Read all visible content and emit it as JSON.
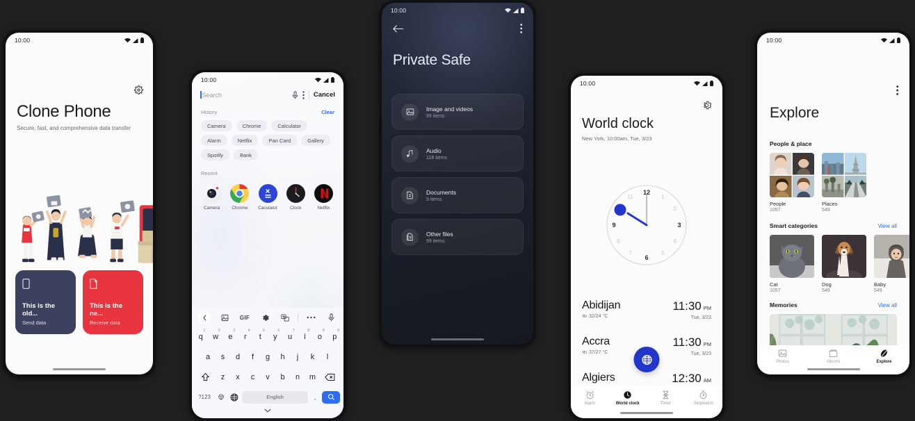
{
  "clone_phone": {
    "status_time": "10:00",
    "title": "Clone Phone",
    "subtitle": "Secure, fast, and comprehensive data transfer",
    "cards": [
      {
        "title": "This is the old...",
        "subtitle": "Send data",
        "color": "#3c4160",
        "icon": "phone-icon"
      },
      {
        "title": "This is the ne...",
        "subtitle": "Receive data",
        "color": "#e7343f",
        "icon": "phone-new-icon"
      }
    ]
  },
  "search_phone": {
    "status_time": "10:00",
    "search_placeholder": "Search",
    "cancel_label": "Cancel",
    "history_label": "History",
    "clear_label": "Clear",
    "history_chips": [
      "Camera",
      "Chrome",
      "Calculator",
      "Alarm",
      "Netflix",
      "Pan Card",
      "Gallery",
      "Spotify",
      "Bank"
    ],
    "recent_label": "Recent",
    "recent_apps": [
      {
        "label": "Camera"
      },
      {
        "label": "Chrome"
      },
      {
        "label": "Caculator"
      },
      {
        "label": "Clock"
      },
      {
        "label": "Netflix"
      }
    ],
    "keyboard": {
      "gif_label": "GIF",
      "row1": [
        {
          "key": "q",
          "num": "1"
        },
        {
          "key": "w",
          "num": "2"
        },
        {
          "key": "e",
          "num": "3"
        },
        {
          "key": "r",
          "num": "4"
        },
        {
          "key": "t",
          "num": "5"
        },
        {
          "key": "y",
          "num": "6"
        },
        {
          "key": "u",
          "num": "7"
        },
        {
          "key": "i",
          "num": "8"
        },
        {
          "key": "o",
          "num": "9"
        },
        {
          "key": "p",
          "num": "0"
        }
      ],
      "row2": [
        "a",
        "s",
        "d",
        "f",
        "g",
        "h",
        "j",
        "k",
        "l"
      ],
      "row3": [
        "z",
        "x",
        "c",
        "v",
        "b",
        "n",
        "m"
      ],
      "symbols_key": "?123",
      "space_label": "English",
      "comma_key": ",",
      "period_key": "."
    }
  },
  "private_safe": {
    "status_time": "10:00",
    "title": "Private Safe",
    "items": [
      {
        "title": "Image and videos",
        "count": "99 items",
        "icon": "image-icon"
      },
      {
        "title": "Audio",
        "count": "118 items",
        "icon": "music-note-icon"
      },
      {
        "title": "Documents",
        "count": "9 items",
        "icon": "document-icon"
      },
      {
        "title": "Other files",
        "count": "99 items",
        "icon": "file-icon"
      }
    ]
  },
  "world_clock": {
    "status_time": "10:00",
    "title": "World clock",
    "subtitle": "New York, 10:00am, Tue, 3/23",
    "clock": {
      "hour_marks": [
        "12",
        "1",
        "2",
        "3",
        "4",
        "5",
        "6",
        "7",
        "8",
        "9",
        "10",
        "11"
      ],
      "hour_hand_deg": 305,
      "minute_hand_deg": 0,
      "marker_deg": 318,
      "accent": "#2237c9"
    },
    "cities": [
      {
        "name": "Abidijan",
        "temp": "32/24 °C",
        "time": "11:30",
        "ampm": "PM",
        "date": "Tue, 3/23"
      },
      {
        "name": "Accra",
        "temp": "37/27 °C",
        "time": "11:30",
        "ampm": "PM",
        "date": "Tue, 3/23"
      },
      {
        "name": "Algiers",
        "temp": "",
        "time": "12:30",
        "ampm": "AM",
        "date": ""
      }
    ],
    "nav": [
      {
        "label": "Alarm",
        "icon": "alarm-icon",
        "active": false
      },
      {
        "label": "World clock",
        "icon": "globe-clock-icon",
        "active": true
      },
      {
        "label": "Timer",
        "icon": "hourglass-icon",
        "active": false
      },
      {
        "label": "Stopwatch",
        "icon": "stopwatch-icon",
        "active": false
      }
    ]
  },
  "explore": {
    "status_time": "10:00",
    "title": "Explore",
    "sections": {
      "people_place": {
        "title": "People & place",
        "tiles": [
          {
            "label": "People",
            "count": "1057"
          },
          {
            "label": "Places",
            "count": "549"
          }
        ]
      },
      "smart_categories": {
        "title": "Smart categories",
        "view_all": "View all",
        "tiles": [
          {
            "label": "Cat",
            "count": "1057"
          },
          {
            "label": "Dog",
            "count": "549"
          },
          {
            "label": "Baby",
            "count": "549"
          }
        ]
      },
      "memories": {
        "title": "Memories",
        "view_all": "View all"
      }
    },
    "nav": [
      {
        "label": "Photos",
        "icon": "photo-icon",
        "active": false
      },
      {
        "label": "Albums",
        "icon": "albums-icon",
        "active": false
      },
      {
        "label": "Explore",
        "icon": "explore-icon",
        "active": true
      }
    ]
  }
}
